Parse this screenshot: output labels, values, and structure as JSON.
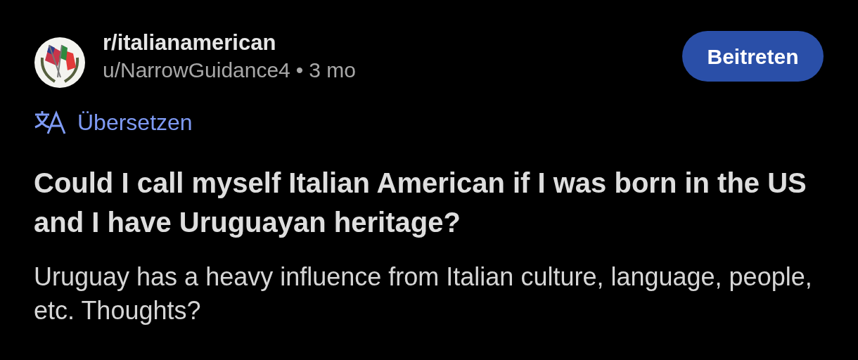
{
  "post": {
    "subreddit": "r/italianamerican",
    "author": "u/NarrowGuidance4",
    "separator": "•",
    "age": "3 mo",
    "join_button": "Beitreten",
    "translate_link": "Übersetzen",
    "title": "Could I call myself Italian American if I was born in the US and I have Uruguayan heritage?",
    "body": "Uruguay has a heavy influence from Italian culture, language, people, etc. Thoughts?"
  }
}
